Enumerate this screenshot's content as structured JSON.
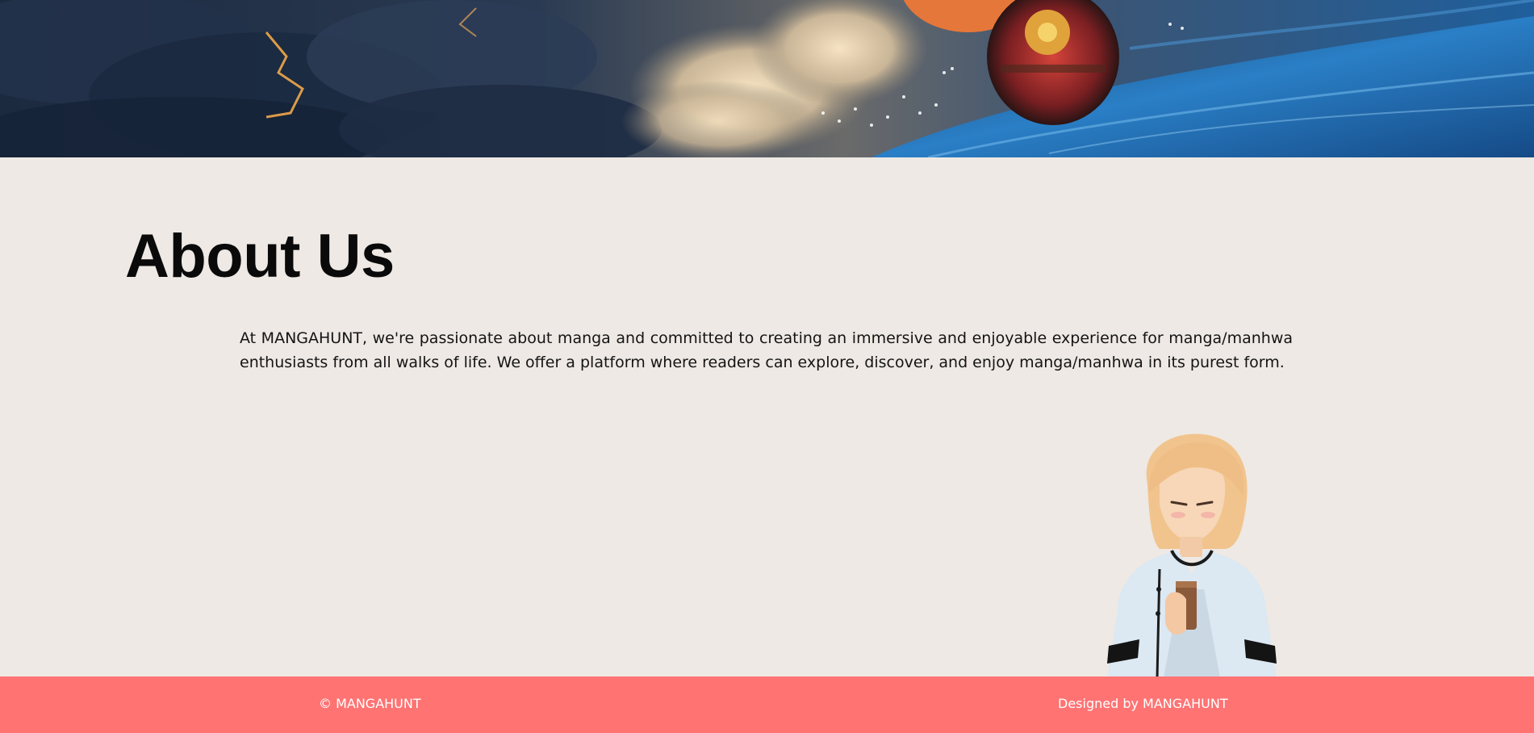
{
  "banner": {
    "image": "anime-sky-airship-banner"
  },
  "about": {
    "title": "About Us",
    "text": "At MANGAHUNT, we're passionate about manga and committed to creating an immersive and enjoyable experience for manga/manhwa enthusiasts from all walks of life. We offer a platform where readers can explore, discover, and enjoy manga/manhwa in its purest form."
  },
  "illustration": {
    "image": "manhwa-girl-holding-cup"
  },
  "footer": {
    "copyright": "© MANGAHUNT",
    "credit": "Designed by MANGAHUNT"
  },
  "colors": {
    "background": "#eee9e4",
    "footer": "#ff7373",
    "footer_text": "#ffffff",
    "title": "#0a0a0a"
  }
}
